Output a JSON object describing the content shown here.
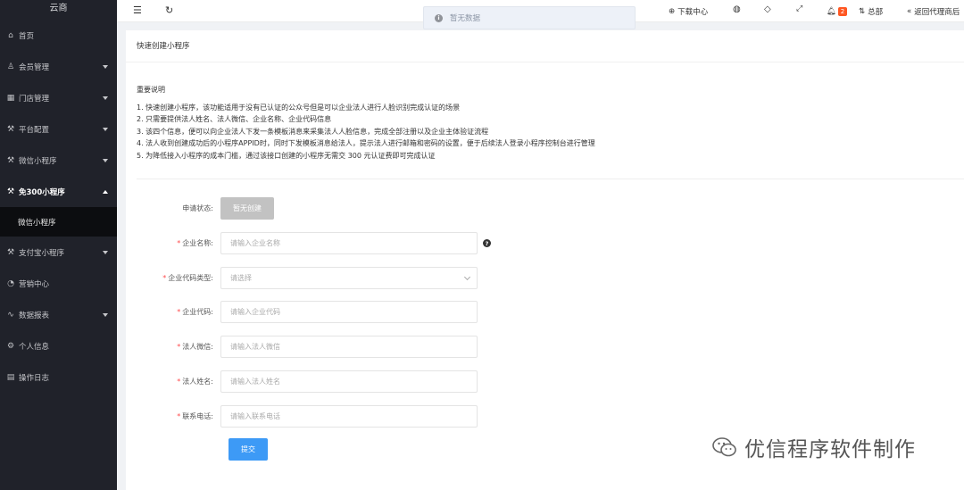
{
  "sidebar": {
    "brand": "云商",
    "items": [
      {
        "label": "首页",
        "icon": "⌂"
      },
      {
        "label": "会员管理",
        "icon": "♙"
      },
      {
        "label": "门店管理",
        "icon": "▦"
      },
      {
        "label": "平台配置",
        "icon": "⚒"
      },
      {
        "label": "微信小程序",
        "icon": "⚒"
      },
      {
        "label": "免300小程序",
        "icon": "⚒"
      },
      {
        "label": "支付宝小程序",
        "icon": "⚒"
      },
      {
        "label": "营销中心",
        "icon": "◔"
      },
      {
        "label": "数据报表",
        "icon": "∿"
      },
      {
        "label": "个人信息",
        "icon": "⚙"
      },
      {
        "label": "操作日志",
        "icon": "▤"
      }
    ],
    "sub_item": "微信小程序"
  },
  "topbar": {
    "download": "下载中心",
    "badge": "2",
    "headquarters": "总部",
    "return": "返回代理商后"
  },
  "toast": {
    "text": "暂无数据"
  },
  "card": {
    "title": "快速创建小程序",
    "notice_title": "重要说明",
    "notice_lines": [
      "1. 快速创建小程序，该功能适用于没有已认证的公众号但是可以企业法人进行人脸识别完成认证的场景",
      "2. 只需要提供法人姓名、法人微信、企业名称、企业代码信息",
      "3. 该四个信息，便可以向企业法人下发一条模板消息来采集法人人脸信息，完成全部注册以及企业主体验证流程",
      "4. 法人收到创建成功后的小程序APPID时，同时下发模板消息给法人，提示法人进行邮箱和密码的设置，便于后续法人登录小程序控制台进行管理",
      "5. 为降低接入小程序的成本门槛，通过该接口创建的小程序无需交 300 元认证费即可完成认证"
    ]
  },
  "form": {
    "status_label": "申请状态:",
    "status_value": "暂无创建",
    "company_name_label": "企业名称:",
    "company_name_placeholder": "请输入企业名称",
    "code_type_label": "企业代码类型:",
    "code_type_placeholder": "请选择",
    "code_label": "企业代码:",
    "code_placeholder": "请输入企业代码",
    "wechat_label": "法人微信:",
    "wechat_placeholder": "请输入法人微信",
    "name_label": "法人姓名:",
    "name_placeholder": "请输入法人姓名",
    "phone_label": "联系电话:",
    "phone_placeholder": "请输入联系电话",
    "submit": "提交"
  },
  "watermark": {
    "text": "优信程序软件制作"
  }
}
